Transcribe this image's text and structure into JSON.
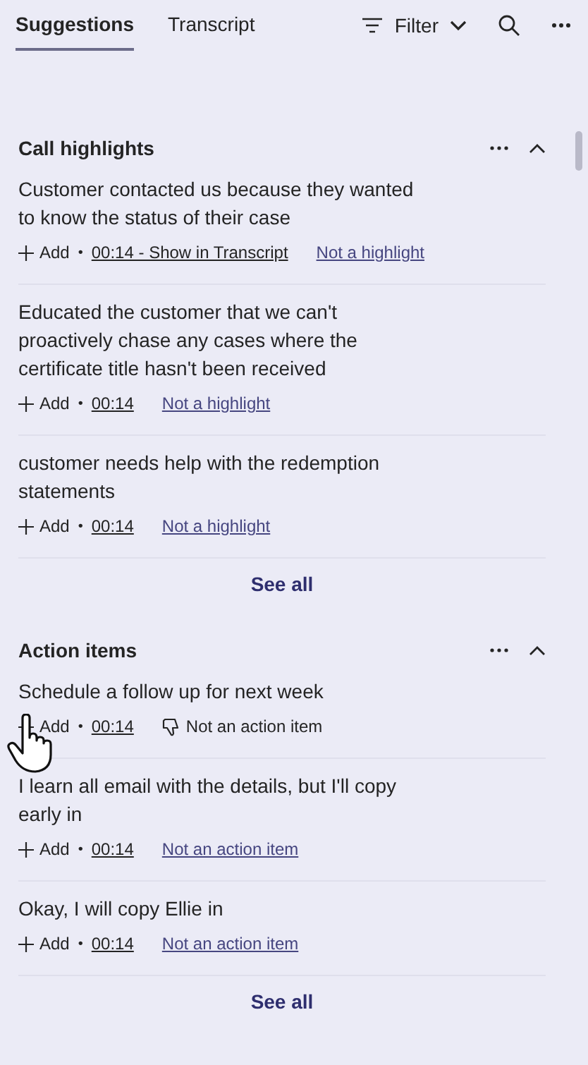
{
  "tabs": [
    {
      "label": "Suggestions",
      "selected": true
    },
    {
      "label": "Transcript",
      "selected": false
    }
  ],
  "toolbar": {
    "filter_label": "Filter"
  },
  "sections": [
    {
      "title": "Call highlights",
      "expanded": true,
      "see_all": "See all",
      "items": [
        {
          "text": "Customer contacted us because they wanted to know the status of their case",
          "add_label": "Add",
          "separator": "•",
          "time": "00:14 - Show in Transcript",
          "dismiss_label": "Not a highlight",
          "hovered": false
        },
        {
          "text": "Educated the customer that we can't proactively chase any cases where the certificate title hasn't been received",
          "add_label": "Add",
          "separator": "•",
          "time": "00:14",
          "dismiss_label": "Not a highlight",
          "hovered": false
        },
        {
          "text": "customer needs help with the redemption statements",
          "add_label": "Add",
          "separator": "•",
          "time": "00:14",
          "dismiss_label": "Not a highlight",
          "hovered": false
        }
      ]
    },
    {
      "title": "Action items",
      "expanded": true,
      "see_all": "See all",
      "items": [
        {
          "text": "Schedule a follow up for next week",
          "add_label": "Add",
          "separator": "•",
          "time": "00:14",
          "dismiss_label": "Not an action item",
          "hovered": true
        },
        {
          "text": "I learn all email with the details, but I'll copy early in",
          "add_label": "Add",
          "separator": "•",
          "time": "00:14",
          "dismiss_label": "Not an action item",
          "hovered": false
        },
        {
          "text": "Okay, I will copy Ellie in",
          "add_label": "Add",
          "separator": "•",
          "time": "00:14",
          "dismiss_label": "Not an action item",
          "hovered": false
        }
      ]
    }
  ]
}
